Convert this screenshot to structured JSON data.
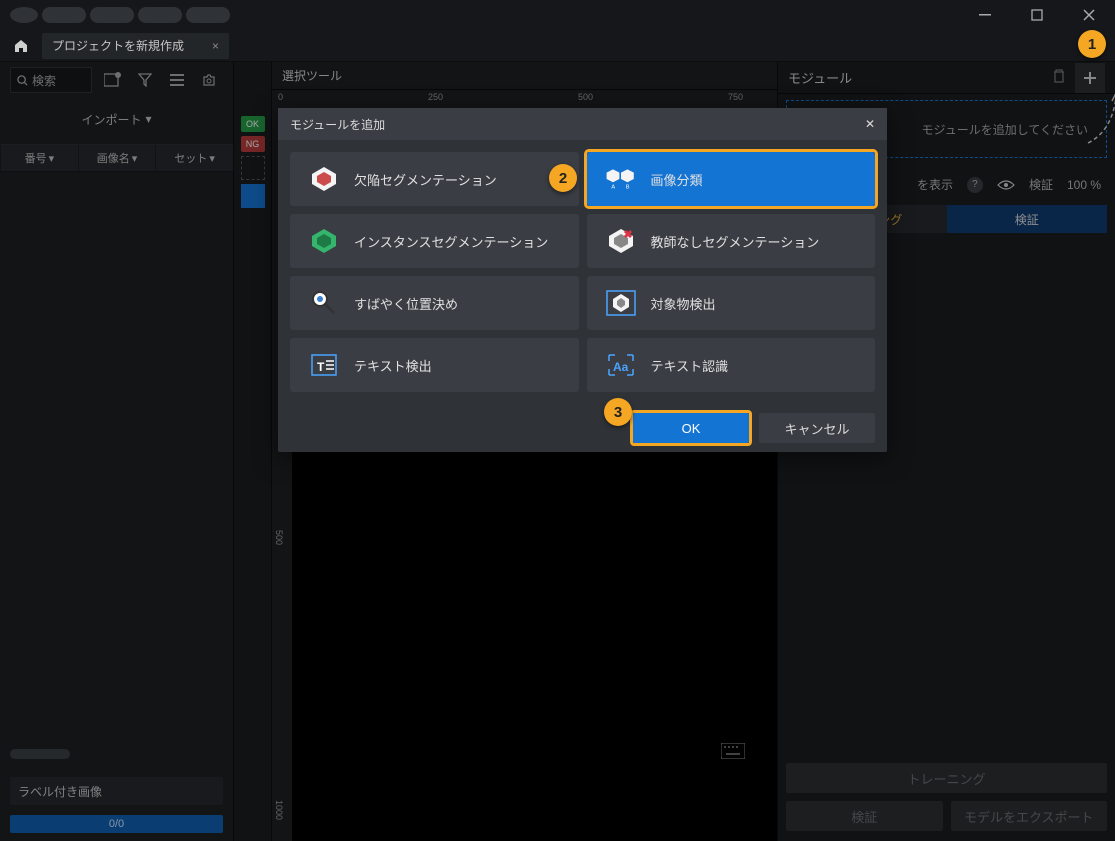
{
  "menus_count": 5,
  "tab": {
    "title": "プロジェクトを新規作成"
  },
  "sidebar": {
    "search_placeholder": "検索",
    "import_label": "インポート",
    "filters": [
      "番号",
      "画像名",
      "セット"
    ],
    "labeled_images_label": "ラベル付き画像",
    "progress_value": "0/0"
  },
  "strip": {
    "ok": "OK",
    "ng": "NG"
  },
  "canvas": {
    "tool_label": "選択ツール",
    "ruler_ticks": [
      0,
      250,
      500,
      750
    ],
    "vruler_ticks": [
      500,
      1000
    ]
  },
  "right": {
    "header": "モジュール",
    "drop_prompt": "モジュールを追加してください",
    "show_label": "を表示",
    "verify_label": "検証",
    "verify_pct": "100 %",
    "tab_training": "トレーニング",
    "tab_validation": "検証",
    "btn_training": "トレーニング",
    "btn_verify": "検証",
    "btn_export": "モデルをエクスポート"
  },
  "modal": {
    "title": "モジュールを追加",
    "cards": [
      {
        "label": "欠陥セグメンテーション",
        "selected": false
      },
      {
        "label": "画像分類",
        "selected": true
      },
      {
        "label": "インスタンスセグメンテーション",
        "selected": false
      },
      {
        "label": "教師なしセグメンテーション",
        "selected": false
      },
      {
        "label": "すばやく位置決め",
        "selected": false
      },
      {
        "label": "対象物検出",
        "selected": false
      },
      {
        "label": "テキスト検出",
        "selected": false
      },
      {
        "label": "テキスト認識",
        "selected": false
      }
    ],
    "ok": "OK",
    "cancel": "キャンセル"
  },
  "annotations": [
    "1",
    "2",
    "3"
  ]
}
